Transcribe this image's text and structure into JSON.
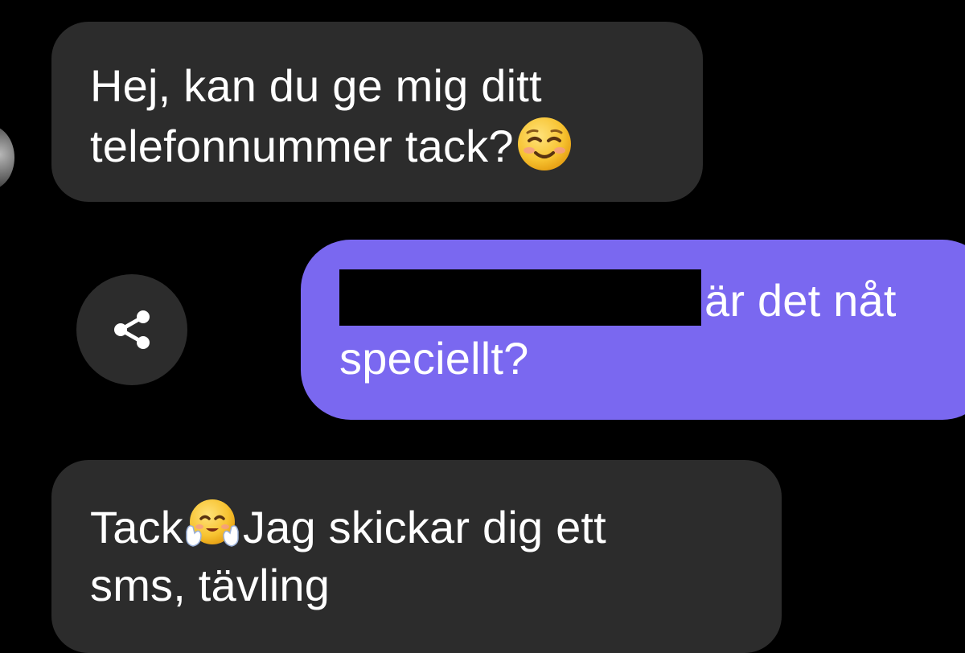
{
  "colors": {
    "background": "#000000",
    "incoming_bubble": "#2c2c2c",
    "outgoing_bubble": "#7a68f0",
    "text": "#ffffff"
  },
  "conversation": {
    "messages": [
      {
        "direction": "incoming",
        "lines": [
          "Hej, kan du ge mig ditt",
          "telefonnummer tack?"
        ],
        "emoji": "smiling-face-with-smiling-eyes"
      },
      {
        "direction": "outgoing",
        "redacted": true,
        "lines": [
          "är det nåt",
          "speciellt?"
        ]
      },
      {
        "direction": "incoming",
        "lines": [
          "Tack",
          "Jag skickar dig ett",
          "sms, tävling"
        ],
        "emoji": "hugging-face"
      }
    ],
    "share_icon": "share-icon"
  }
}
